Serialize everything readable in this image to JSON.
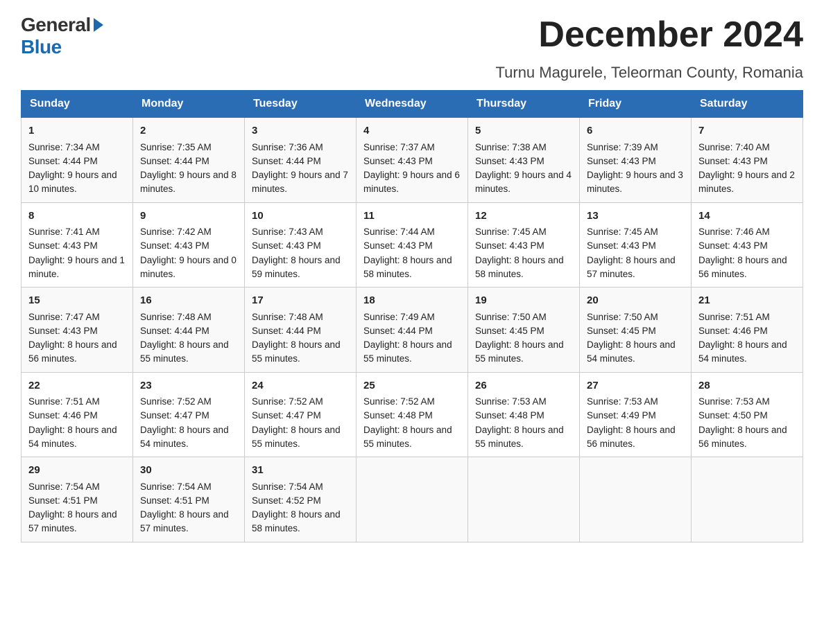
{
  "logo": {
    "general": "General",
    "blue": "Blue"
  },
  "header": {
    "month_title": "December 2024",
    "location": "Turnu Magurele, Teleorman County, Romania"
  },
  "days_of_week": [
    "Sunday",
    "Monday",
    "Tuesday",
    "Wednesday",
    "Thursday",
    "Friday",
    "Saturday"
  ],
  "weeks": [
    [
      {
        "day": "1",
        "sunrise": "7:34 AM",
        "sunset": "4:44 PM",
        "daylight": "9 hours and 10 minutes."
      },
      {
        "day": "2",
        "sunrise": "7:35 AM",
        "sunset": "4:44 PM",
        "daylight": "9 hours and 8 minutes."
      },
      {
        "day": "3",
        "sunrise": "7:36 AM",
        "sunset": "4:44 PM",
        "daylight": "9 hours and 7 minutes."
      },
      {
        "day": "4",
        "sunrise": "7:37 AM",
        "sunset": "4:43 PM",
        "daylight": "9 hours and 6 minutes."
      },
      {
        "day": "5",
        "sunrise": "7:38 AM",
        "sunset": "4:43 PM",
        "daylight": "9 hours and 4 minutes."
      },
      {
        "day": "6",
        "sunrise": "7:39 AM",
        "sunset": "4:43 PM",
        "daylight": "9 hours and 3 minutes."
      },
      {
        "day": "7",
        "sunrise": "7:40 AM",
        "sunset": "4:43 PM",
        "daylight": "9 hours and 2 minutes."
      }
    ],
    [
      {
        "day": "8",
        "sunrise": "7:41 AM",
        "sunset": "4:43 PM",
        "daylight": "9 hours and 1 minute."
      },
      {
        "day": "9",
        "sunrise": "7:42 AM",
        "sunset": "4:43 PM",
        "daylight": "9 hours and 0 minutes."
      },
      {
        "day": "10",
        "sunrise": "7:43 AM",
        "sunset": "4:43 PM",
        "daylight": "8 hours and 59 minutes."
      },
      {
        "day": "11",
        "sunrise": "7:44 AM",
        "sunset": "4:43 PM",
        "daylight": "8 hours and 58 minutes."
      },
      {
        "day": "12",
        "sunrise": "7:45 AM",
        "sunset": "4:43 PM",
        "daylight": "8 hours and 58 minutes."
      },
      {
        "day": "13",
        "sunrise": "7:45 AM",
        "sunset": "4:43 PM",
        "daylight": "8 hours and 57 minutes."
      },
      {
        "day": "14",
        "sunrise": "7:46 AM",
        "sunset": "4:43 PM",
        "daylight": "8 hours and 56 minutes."
      }
    ],
    [
      {
        "day": "15",
        "sunrise": "7:47 AM",
        "sunset": "4:43 PM",
        "daylight": "8 hours and 56 minutes."
      },
      {
        "day": "16",
        "sunrise": "7:48 AM",
        "sunset": "4:44 PM",
        "daylight": "8 hours and 55 minutes."
      },
      {
        "day": "17",
        "sunrise": "7:48 AM",
        "sunset": "4:44 PM",
        "daylight": "8 hours and 55 minutes."
      },
      {
        "day": "18",
        "sunrise": "7:49 AM",
        "sunset": "4:44 PM",
        "daylight": "8 hours and 55 minutes."
      },
      {
        "day": "19",
        "sunrise": "7:50 AM",
        "sunset": "4:45 PM",
        "daylight": "8 hours and 55 minutes."
      },
      {
        "day": "20",
        "sunrise": "7:50 AM",
        "sunset": "4:45 PM",
        "daylight": "8 hours and 54 minutes."
      },
      {
        "day": "21",
        "sunrise": "7:51 AM",
        "sunset": "4:46 PM",
        "daylight": "8 hours and 54 minutes."
      }
    ],
    [
      {
        "day": "22",
        "sunrise": "7:51 AM",
        "sunset": "4:46 PM",
        "daylight": "8 hours and 54 minutes."
      },
      {
        "day": "23",
        "sunrise": "7:52 AM",
        "sunset": "4:47 PM",
        "daylight": "8 hours and 54 minutes."
      },
      {
        "day": "24",
        "sunrise": "7:52 AM",
        "sunset": "4:47 PM",
        "daylight": "8 hours and 55 minutes."
      },
      {
        "day": "25",
        "sunrise": "7:52 AM",
        "sunset": "4:48 PM",
        "daylight": "8 hours and 55 minutes."
      },
      {
        "day": "26",
        "sunrise": "7:53 AM",
        "sunset": "4:48 PM",
        "daylight": "8 hours and 55 minutes."
      },
      {
        "day": "27",
        "sunrise": "7:53 AM",
        "sunset": "4:49 PM",
        "daylight": "8 hours and 56 minutes."
      },
      {
        "day": "28",
        "sunrise": "7:53 AM",
        "sunset": "4:50 PM",
        "daylight": "8 hours and 56 minutes."
      }
    ],
    [
      {
        "day": "29",
        "sunrise": "7:54 AM",
        "sunset": "4:51 PM",
        "daylight": "8 hours and 57 minutes."
      },
      {
        "day": "30",
        "sunrise": "7:54 AM",
        "sunset": "4:51 PM",
        "daylight": "8 hours and 57 minutes."
      },
      {
        "day": "31",
        "sunrise": "7:54 AM",
        "sunset": "4:52 PM",
        "daylight": "8 hours and 58 minutes."
      },
      null,
      null,
      null,
      null
    ]
  ],
  "cell_labels": {
    "sunrise": "Sunrise:",
    "sunset": "Sunset:",
    "daylight": "Daylight:"
  }
}
